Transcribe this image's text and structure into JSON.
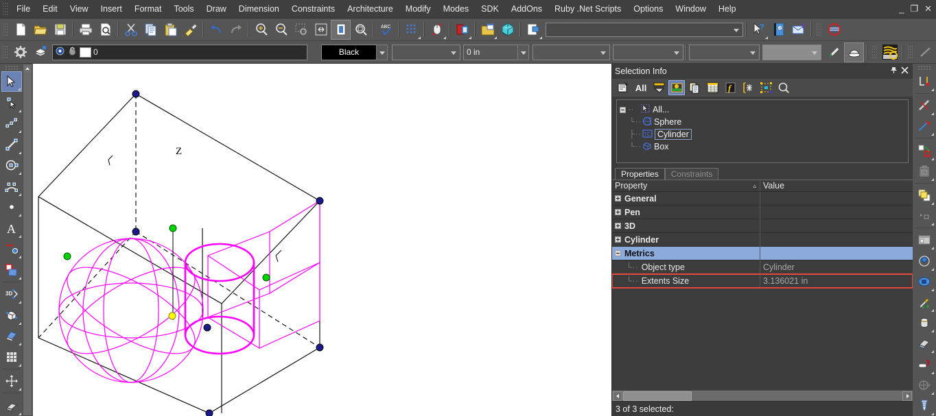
{
  "window": {
    "minimize_label": "_",
    "restore_label": "❐",
    "close_label": "✕"
  },
  "menubar": {
    "items": [
      {
        "label": "File",
        "name": "menu-file"
      },
      {
        "label": "Edit",
        "name": "menu-edit"
      },
      {
        "label": "View",
        "name": "menu-view"
      },
      {
        "label": "Insert",
        "name": "menu-insert"
      },
      {
        "label": "Format",
        "name": "menu-format"
      },
      {
        "label": "Tools",
        "name": "menu-tools"
      },
      {
        "label": "Draw",
        "name": "menu-draw"
      },
      {
        "label": "Dimension",
        "name": "menu-dimension"
      },
      {
        "label": "Constraints",
        "name": "menu-constraints"
      },
      {
        "label": "Architecture",
        "name": "menu-architecture"
      },
      {
        "label": "Modify",
        "name": "menu-modify"
      },
      {
        "label": "Modes",
        "name": "menu-modes"
      },
      {
        "label": "SDK",
        "name": "menu-sdk"
      },
      {
        "label": "AddOns",
        "name": "menu-addons"
      },
      {
        "label": "Ruby .Net Scripts",
        "name": "menu-ruby-net-scripts"
      },
      {
        "label": "Options",
        "name": "menu-options"
      },
      {
        "label": "Window",
        "name": "menu-window"
      },
      {
        "label": "Help",
        "name": "menu-help"
      }
    ]
  },
  "toolbar_main": {
    "icons": [
      "new-document-icon",
      "open-folder-icon",
      "save-icon",
      "print-icon",
      "print-preview-icon",
      "cut-scissors-icon",
      "copy-icon",
      "paste-icon",
      "format-painter-icon",
      "undo-icon",
      "redo-icon",
      "zoom-in-icon",
      "zoom-out-icon",
      "zoom-window-icon",
      "zoom-extents-icon",
      "zoom-page-icon",
      "zoom-previous-icon",
      "spell-check-icon",
      "snap-grid-icon",
      "mouse-settings-icon",
      "render-icon",
      "open-library-icon",
      "3d-view-icon",
      "export-icon"
    ],
    "command_combo_value": "",
    "right_icons": [
      "context-help-icon",
      "address-book-icon",
      "send-mail-icon",
      "no-hatch-icon"
    ]
  },
  "toolbar_properties": {
    "settings_icon": "gear-icon",
    "layers_icon": "layers-icon",
    "layer_value": "0",
    "color_value": "Black",
    "linetype_value": "",
    "lineweight_value": "0 in",
    "textstyle_value": "",
    "dimstyle_value": "",
    "hatch_value": "",
    "scale_value": "",
    "pen_icon": "pen-icon",
    "render-style-icon": "render-style-icon",
    "hatch_icon": "hatch-pattern-icon",
    "line_icon": "line-style-icon"
  },
  "left_toolbar": {
    "items": [
      {
        "name": "select-tool",
        "active": true
      },
      {
        "name": "node-edit-tool",
        "active": false
      },
      {
        "name": "point-line-tool",
        "active": false
      },
      {
        "name": "line-tool",
        "active": false
      },
      {
        "name": "circle-tool",
        "active": false
      },
      {
        "name": "arc-tool",
        "active": false
      },
      {
        "name": "point-tool",
        "active": false
      },
      {
        "name": "text-tool",
        "active": false
      },
      {
        "name": "dimension-tool",
        "active": false
      },
      {
        "name": "hatch-fill-tool",
        "active": false
      },
      {
        "name": "3d-tool",
        "active": false
      },
      {
        "name": "box-solid-tool",
        "active": false
      },
      {
        "name": "extrude-tool",
        "active": false
      },
      {
        "name": "grid-array-tool",
        "active": false
      },
      {
        "name": "move-tool",
        "active": false
      },
      {
        "name": "wall-tool",
        "active": false
      }
    ]
  },
  "right_toolbar": {
    "items": [
      {
        "name": "corner-dimension-icon"
      },
      {
        "name": "clean-intersection-icon"
      },
      {
        "name": "trim-extend-icon"
      },
      {
        "name": "copy-offset-icon"
      },
      {
        "name": "paste-special-icon"
      },
      {
        "name": "bring-to-front-icon"
      },
      {
        "name": "align-icon"
      },
      {
        "name": "window-tool-icon"
      },
      {
        "name": "rotate-3d-icon"
      },
      {
        "name": "shade-icon"
      },
      {
        "name": "magic-wand-icon"
      },
      {
        "name": "cylinder-solid-icon"
      },
      {
        "name": "sweep-icon"
      },
      {
        "name": "bend-icon"
      },
      {
        "name": "mesh-icon"
      },
      {
        "name": "screw-icon"
      }
    ]
  },
  "canvas": {
    "axis_label_z": "Z",
    "selection_color": "#ff00ff",
    "geometry_color": "#000000",
    "handle_blue": "#1a1a8c",
    "handle_green": "#00d400",
    "handle_yellow": "#ffff00",
    "background": "#ffffff"
  },
  "selection_panel": {
    "title": "Selection Info",
    "pin_icon": "pin-icon",
    "close_icon": "close-icon",
    "toolbar": [
      {
        "name": "select-mode-icon",
        "label": "",
        "selected": false
      },
      {
        "name": "select-all-icon",
        "label": "All",
        "selected": false
      },
      {
        "name": "filter-icon",
        "label": "",
        "selected": false
      },
      {
        "name": "highlight-icon",
        "label": "",
        "selected": true
      },
      {
        "name": "copy-properties-icon",
        "label": "",
        "selected": false
      },
      {
        "name": "table-view-icon",
        "label": "",
        "selected": false
      },
      {
        "name": "function-icon",
        "label": "",
        "selected": false
      },
      {
        "name": "snap-node-icon",
        "label": "",
        "selected": false
      },
      {
        "name": "bounding-box-icon",
        "label": "",
        "selected": false
      },
      {
        "name": "zoom-selection-icon",
        "label": "",
        "selected": false
      }
    ],
    "tree": {
      "root": {
        "label": "All...",
        "icon": "selection-root-icon",
        "expanded": true
      },
      "children": [
        {
          "label": "Sphere",
          "icon": "sphere-icon",
          "selected": false
        },
        {
          "label": "Cylinder",
          "icon": "cylinder-icon",
          "selected": true
        },
        {
          "label": "Box",
          "icon": "box-icon",
          "selected": false
        }
      ]
    },
    "tabs": [
      {
        "label": "Properties",
        "active": true,
        "name": "tab-properties"
      },
      {
        "label": "Constraints",
        "active": false,
        "name": "tab-constraints"
      }
    ],
    "grid": {
      "columns": [
        "Property",
        "Value"
      ],
      "sort_indicator": "▵",
      "rows": [
        {
          "label": "General",
          "value": "",
          "type": "group",
          "expanded": false,
          "selected": false,
          "highlight": false
        },
        {
          "label": "Pen",
          "value": "",
          "type": "group",
          "expanded": false,
          "selected": false,
          "highlight": false
        },
        {
          "label": "3D",
          "value": "",
          "type": "group",
          "expanded": false,
          "selected": false,
          "highlight": false
        },
        {
          "label": "Cylinder",
          "value": "",
          "type": "group",
          "expanded": false,
          "selected": false,
          "highlight": false
        },
        {
          "label": "Metrics",
          "value": "",
          "type": "group",
          "expanded": true,
          "selected": true,
          "highlight": false
        },
        {
          "label": "Object type",
          "value": "Cylinder",
          "type": "item",
          "selected": false,
          "highlight": false
        },
        {
          "label": "Extents Size",
          "value": "3.136021 in",
          "type": "item",
          "selected": false,
          "highlight": true
        }
      ]
    },
    "status": "3 of 3 selected:"
  }
}
